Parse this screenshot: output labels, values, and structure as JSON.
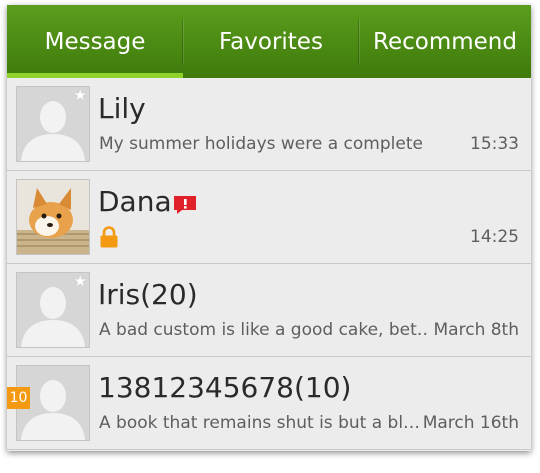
{
  "tabs": [
    {
      "label": "Message",
      "active": true
    },
    {
      "label": "Favorites",
      "active": false
    },
    {
      "label": "Recommend",
      "active": false
    }
  ],
  "conversations": [
    {
      "name": "Lily",
      "preview": "My summer holidays were a complete",
      "time": "15:33",
      "avatar": "default-avatar",
      "starred": true
    },
    {
      "name": "Dana",
      "preview": "",
      "time": "14:25",
      "avatar": "dog-photo",
      "alert": "alert-icon",
      "locked": "lock-icon"
    },
    {
      "name": "Iris(20)",
      "preview": "A bad custom is like a good cake, bet…",
      "time": "March 8th",
      "avatar": "default-avatar",
      "starred": true
    },
    {
      "name": "13812345678(10)",
      "preview": "A book that remains shut is but a bl…",
      "time": "March 16th",
      "avatar": "default-avatar",
      "badge": "10"
    }
  ],
  "colors": {
    "tab_bar": "#4b8a13",
    "tab_active_indicator": "#8fd22a",
    "alert": "#e0212a",
    "lock": "#f39a12",
    "badge": "#f39a12"
  }
}
